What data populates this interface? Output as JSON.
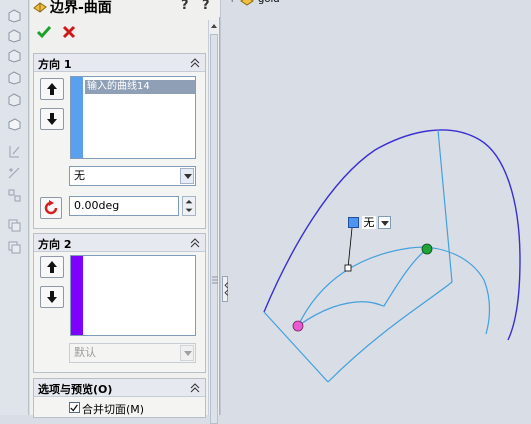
{
  "panel": {
    "title": "边界-曲面",
    "help_glyph": "?",
    "close_glyph": "?"
  },
  "direction1": {
    "header": "方向 1",
    "items": [
      "输入的曲线14"
    ],
    "stripe_color": "#5aa0ef",
    "tangency_value": "无",
    "angle_value": "0.00deg"
  },
  "direction2": {
    "header": "方向 2",
    "items": [],
    "stripe_color": "#8000ff",
    "tangency_value": "默认"
  },
  "options": {
    "header": "选项与预览(O)",
    "merge_label": "合并切面(M)",
    "merge_checked": true
  },
  "tree": {
    "node_label": "gold"
  },
  "callout": {
    "label": "无"
  },
  "colors": {
    "curve_dark": "#3a2fd0",
    "curve_light": "#44a0dc",
    "start_point": "#e85ad0",
    "end_point": "#1fa43a"
  }
}
